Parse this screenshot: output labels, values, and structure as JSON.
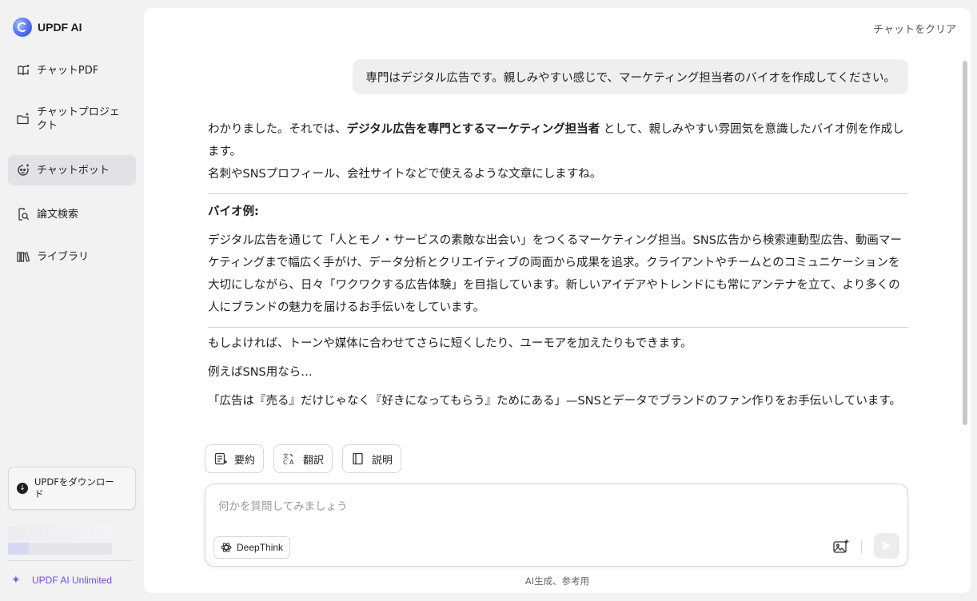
{
  "app": {
    "name": "UPDF AI"
  },
  "sidebar": {
    "items": [
      {
        "label": "チャットPDF",
        "icon": "book-sparkle-icon"
      },
      {
        "label": "チャットプロジェクト",
        "icon": "folder-sparkle-icon"
      },
      {
        "label": "チャットボット",
        "icon": "bot-icon",
        "active": true
      },
      {
        "label": "論文検索",
        "icon": "paper-search-icon"
      },
      {
        "label": "ライブラリ",
        "icon": "library-icon"
      }
    ],
    "download_label": "UPDFをダウンロード",
    "usage_fraction": 0.2,
    "unlimited_label": "UPDF AI Unlimited"
  },
  "header": {
    "clear_chat": "チャットをクリア"
  },
  "conversation": {
    "user_message": "専門はデジタル広告です。親しみやすい感じで、マーケティング担当者のバイオを作成してください。",
    "answer": {
      "intro_pre": "わかりました。それでは、",
      "intro_bold": "デジタル広告を専門とするマーケティング担当者",
      "intro_post": " として、親しみやすい雰囲気を意識したバイオ例を作成します。",
      "intro_line2": "名刺やSNSプロフィール、会社サイトなどで使えるような文章にしますね。",
      "bio_heading": "バイオ例:",
      "bio_text": "デジタル広告を通じて「人とモノ・サービスの素敵な出会い」をつくるマーケティング担当。SNS広告から検索連動型広告、動画マーケティングまで幅広く手がけ、データ分析とクリエイティブの両面から成果を追求。クライアントやチームとのコミュニケーションを大切にしながら、日々「ワクワクする広告体験」を目指しています。新しいアイデアやトレンドにも常にアンテナを立て、より多くの人にブランドの魅力を届けるお手伝いをしています。",
      "followup": "もしよければ、トーンや媒体に合わせてさらに短くしたり、ユーモアを加えたりもできます。",
      "sns_intro": "例えばSNS用なら…",
      "sns_example": "「広告は『売る』だけじゃなく『好きになってもらう』ためにある」—SNSとデータでブランドのファン作りをお手伝いしています。"
    }
  },
  "actions": {
    "summarize": "要約",
    "translate": "翻訳",
    "explain": "説明"
  },
  "composer": {
    "placeholder": "何かを質問してみましょう",
    "deepthink_label": "DeepThink"
  },
  "footer": {
    "disclaimer": "AI生成、参考用"
  },
  "colors": {
    "accent": "#6a4cf0",
    "active_nav_bg": "#e2e2e4",
    "background": "#f2f2f3"
  }
}
